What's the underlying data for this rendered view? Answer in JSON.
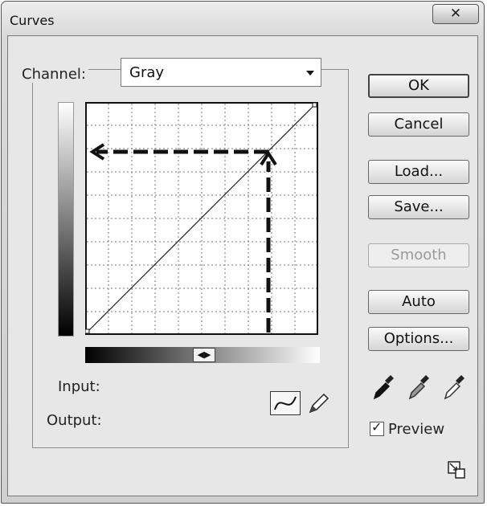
{
  "window": {
    "title": "Curves",
    "close_icon": "close-icon"
  },
  "channel": {
    "label": "Channel:",
    "value": "Gray"
  },
  "curve": {
    "input_label": "Input:",
    "output_label": "Output:"
  },
  "buttons": {
    "ok": "OK",
    "cancel": "Cancel",
    "load": "Load...",
    "save": "Save...",
    "smooth": "Smooth",
    "auto": "Auto",
    "options": "Options..."
  },
  "preview": {
    "label": "Preview",
    "checked": true
  },
  "icons": [
    "curve-tool-icon",
    "pencil-icon",
    "black-eyedropper-icon",
    "gray-eyedropper-icon",
    "white-eyedropper-icon",
    "expand-icon"
  ]
}
